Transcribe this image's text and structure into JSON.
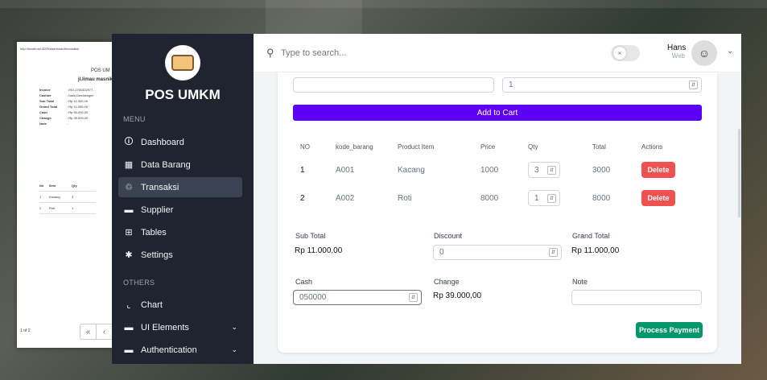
{
  "print_preview": {
    "url": "http://localhost:3000/dashboard/transaksi",
    "title": "POS UM",
    "address": "jl.limau masnik",
    "fields": [
      {
        "key": "Invoice",
        "value": ": INV-1750322977..."
      },
      {
        "key": "Cashier",
        "value": ": hans Dembenger"
      },
      {
        "key": "Sub Total",
        "value": ": Rp 11.000,00"
      },
      {
        "key": "Grand Total",
        "value": ": Rp 11.000,00"
      },
      {
        "key": "Cash",
        "value": ": Rp 50.000,00"
      },
      {
        "key": "Change",
        "value": ": Rp 39.000,00"
      },
      {
        "key": "Note",
        "value": ":"
      }
    ],
    "table": {
      "headers": [
        "No",
        "Item",
        "Qty"
      ],
      "rows": [
        [
          "1",
          "Kacang",
          "3"
        ],
        [
          "2",
          "Roti",
          "1"
        ]
      ]
    },
    "page": "1 of 2",
    "nav_first": "«",
    "nav_prev": "‹"
  },
  "sidebar": {
    "brand": "POS UMKM",
    "menu_label": "MENU",
    "others_label": "OTHERS",
    "items": [
      {
        "label": "Dashboard",
        "icon": "🛈"
      },
      {
        "label": "Data Barang",
        "icon": "▦"
      },
      {
        "label": "Transaksi",
        "icon": "♲"
      },
      {
        "label": "Supplier",
        "icon": "▬"
      },
      {
        "label": "Tables",
        "icon": "⊞"
      },
      {
        "label": "Settings",
        "icon": "✱"
      }
    ],
    "others": [
      {
        "label": "Chart",
        "icon": "⌞"
      },
      {
        "label": "UI Elements",
        "icon": "▬",
        "chevron": "⌄"
      },
      {
        "label": "Authentication",
        "icon": "▬",
        "chevron": "⌄"
      }
    ]
  },
  "topbar": {
    "search_placeholder": "Type to search...",
    "user_name": "Hans",
    "user_role": "Web",
    "chevron": "⌄"
  },
  "form": {
    "product_value": "",
    "qty_value": "1",
    "add_to_cart": "Add to Cart"
  },
  "cart": {
    "headers": [
      "NO",
      "kode_barang",
      "Product Item",
      "Price",
      "Qty",
      "Total",
      "Actions"
    ],
    "rows": [
      {
        "no": "1",
        "kode": "A001",
        "item": "Kacang",
        "price": "1000",
        "qty": "3",
        "total": "3000",
        "action": "Delete"
      },
      {
        "no": "2",
        "kode": "A002",
        "item": "Roti",
        "price": "8000",
        "qty": "1",
        "total": "8000",
        "action": "Delete"
      }
    ]
  },
  "summary": {
    "sub_total_label": "Sub Total",
    "sub_total": "Rp 11.000,00",
    "discount_label": "Discount",
    "discount_value": "0",
    "grand_total_label": "Grand Total",
    "grand_total": "Rp 11.000,00",
    "cash_label": "Cash",
    "cash_value": "050000",
    "change_label": "Change",
    "change_value": "Rp 39.000,00",
    "note_label": "Note",
    "note_value": "",
    "process_payment": "Process Payment"
  }
}
